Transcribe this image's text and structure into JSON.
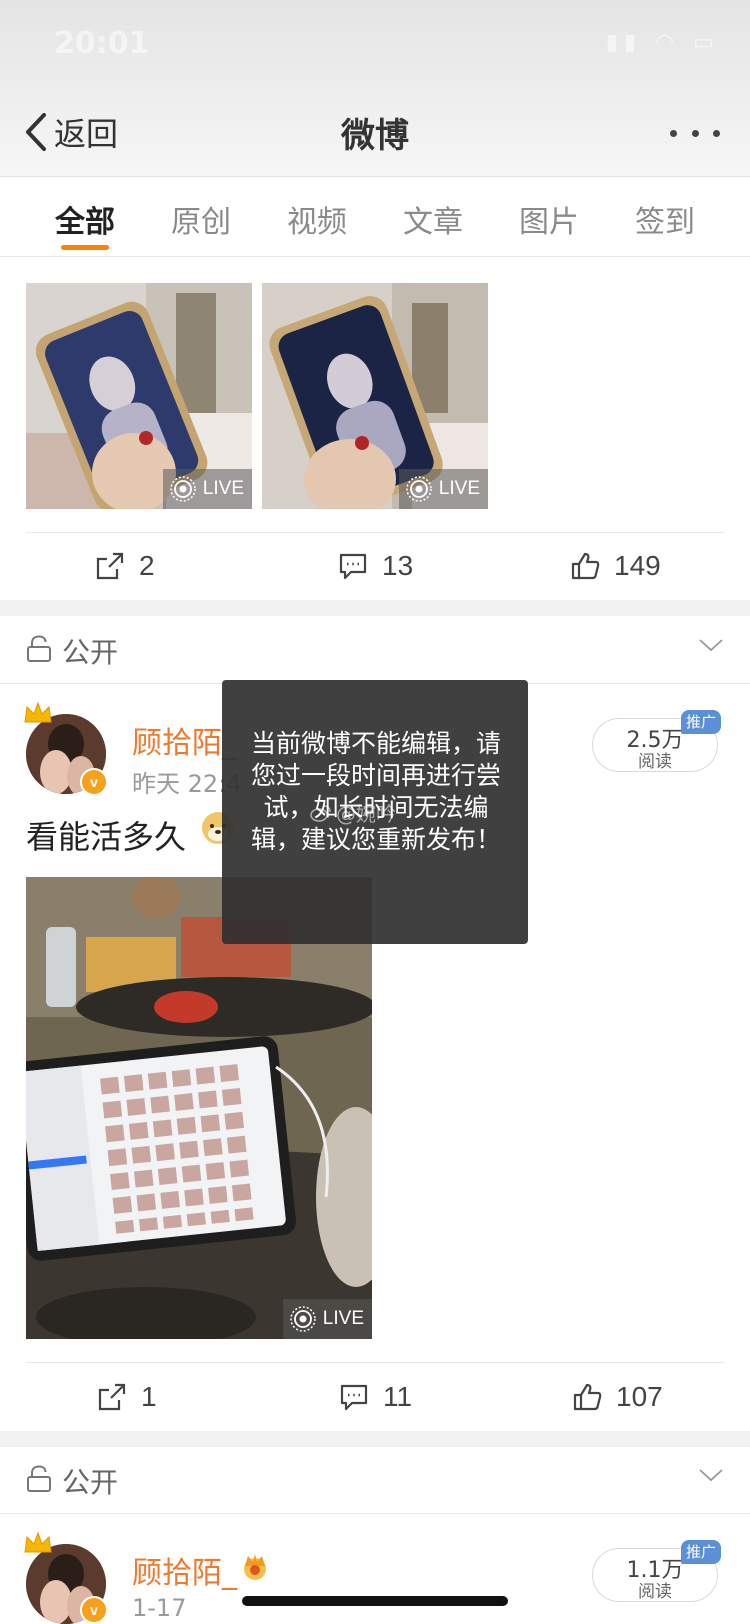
{
  "status_bar": {
    "time": "20:01"
  },
  "nav": {
    "back_label": "返回",
    "title": "微博"
  },
  "tabs": [
    {
      "label": "全部",
      "active": true
    },
    {
      "label": "原创",
      "active": false
    },
    {
      "label": "视频",
      "active": false
    },
    {
      "label": "文章",
      "active": false
    },
    {
      "label": "图片",
      "active": false
    },
    {
      "label": "签到",
      "active": false
    }
  ],
  "post1": {
    "images": [
      {
        "live": "LIVE"
      },
      {
        "live": "LIVE"
      }
    ],
    "repost_count": "2",
    "comment_count": "13",
    "like_count": "149"
  },
  "post2": {
    "visibility": "公开",
    "user_name": "顾拾陌_",
    "time": "昨天 22:4",
    "read_count": "2.5万",
    "read_label": "阅读",
    "promo_tag": "推广",
    "text": "看能活多久",
    "image_live": "LIVE",
    "repost_count": "1",
    "comment_count": "11",
    "like_count": "107"
  },
  "post3": {
    "visibility": "公开",
    "user_name": "顾拾陌_",
    "time": "1-17",
    "read_count": "1.1万",
    "read_label": "阅读",
    "promo_tag": "推广"
  },
  "toast": {
    "message": "当前微博不能编辑，请您过一段时间再进行尝试，如长时间无法编辑，建议您重新发布！",
    "watermark": "@婉吟"
  },
  "colors": {
    "accent_orange": "#ff8200",
    "username_orange": "#ef7a2b",
    "promo_blue": "#5b8fd6"
  }
}
